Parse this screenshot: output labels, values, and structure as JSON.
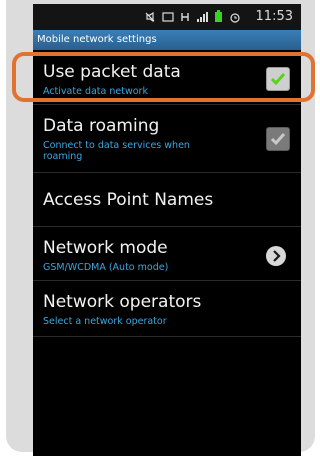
{
  "statusbar": {
    "time": "11:53"
  },
  "titlebar": {
    "title": "Mobile network settings"
  },
  "items": [
    {
      "title": "Use packet data",
      "subtitle": "Activate data network"
    },
    {
      "title": "Data roaming",
      "subtitle": "Connect to data services when roaming"
    },
    {
      "title": "Access Point Names"
    },
    {
      "title": "Network mode",
      "subtitle": "GSM/WCDMA (Auto mode)"
    },
    {
      "title": "Network operators",
      "subtitle": "Select a network operator"
    }
  ],
  "colors": {
    "accent": "#3aa7e0",
    "highlight": "#e2722f",
    "check_green": "#5ad21c"
  },
  "icons": [
    "silent-icon",
    "screenshot-icon",
    "data-h-icon",
    "signal-icon",
    "battery-icon",
    "alarm-icon"
  ]
}
